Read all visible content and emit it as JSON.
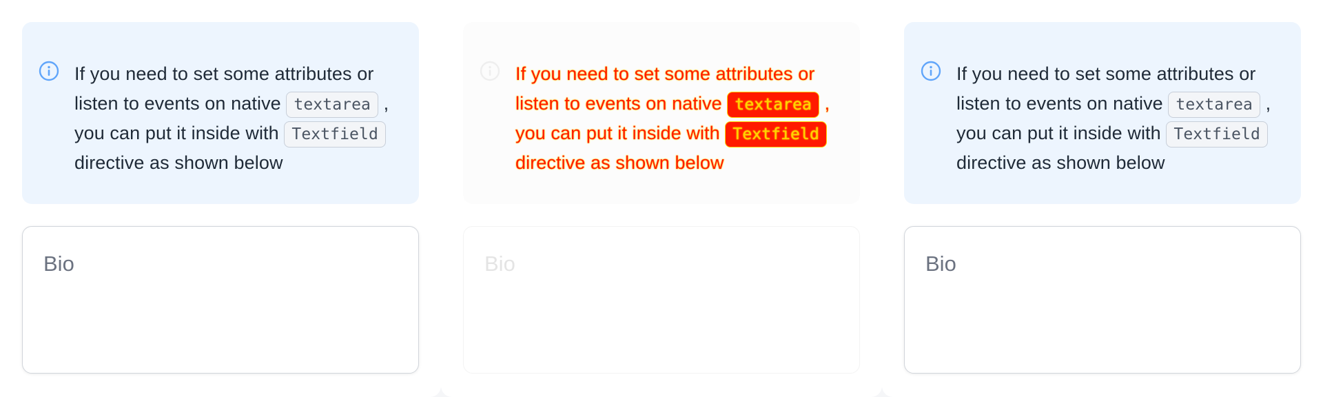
{
  "panels": [
    {
      "alert": {
        "icon": "info-circle-icon",
        "text_before": "If you need to set some attributes or listen to events on native",
        "code_1": "textarea",
        "text_middle": ", you can put it inside with",
        "code_2": "Textfield",
        "text_after": "directive as shown below"
      },
      "textfield": {
        "label": "Bio"
      }
    },
    {
      "alert": {
        "icon": "info-circle-icon",
        "text_before": "If you need to set some attributes or listen to events on native",
        "code_1": "textarea",
        "text_middle": ", you can put it inside with",
        "code_2": "Textfield",
        "text_after": "directive as shown below"
      },
      "textfield": {
        "label": "Bio"
      }
    },
    {
      "alert": {
        "icon": "info-circle-icon",
        "text_before": "If you need to set some attributes or listen to events on native",
        "code_1": "textarea",
        "text_middle": ", you can put it inside with",
        "code_2": "Textfield",
        "text_after": "directive as shown below"
      },
      "textfield": {
        "label": "Bio"
      }
    }
  ],
  "colors": {
    "alert_bg": "#edf5fe",
    "icon_blue": "#60a5fa",
    "text": "#1f2a37",
    "label": "#6b7280"
  }
}
